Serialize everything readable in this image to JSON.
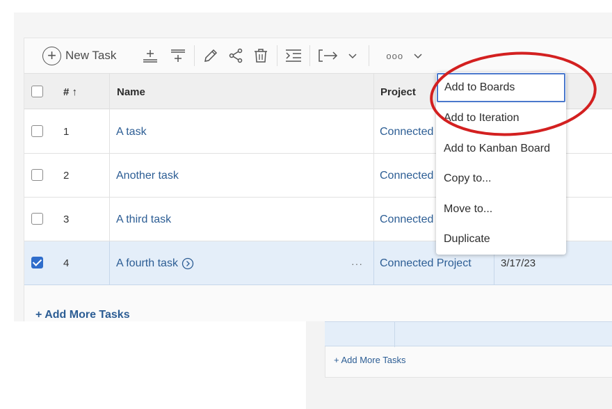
{
  "toolbar": {
    "new_task_label": "New Task",
    "new_task_icon": "plus-circle-icon",
    "icons": [
      "insert-above-icon",
      "insert-below-icon",
      "edit-icon",
      "share-icon",
      "delete-icon",
      "indent-icon",
      "move-icon",
      "chevron-down-icon",
      "more-icon",
      "chevron-down-icon"
    ],
    "more_glyph": "ooo"
  },
  "table": {
    "columns": {
      "number": "# ↑",
      "name": "Name",
      "project": "Project"
    },
    "rows": [
      {
        "number": "1",
        "name": "A task",
        "project": "Connected",
        "checked": false
      },
      {
        "number": "2",
        "name": "Another task",
        "project": "Connected",
        "checked": false
      },
      {
        "number": "3",
        "name": "A third task",
        "project": "Connected",
        "checked": false
      },
      {
        "number": "4",
        "name": "A fourth task",
        "project": "Connected Project",
        "date": "3/17/23",
        "checked": true,
        "row_actions": "···"
      }
    ],
    "add_more": "+ Add More Tasks"
  },
  "context_menu": {
    "items": [
      "Add to Boards",
      "Add to Iteration",
      "Add to Kanban Board",
      "Copy to...",
      "Move to...",
      "Duplicate"
    ],
    "focused_item": "Add to Boards"
  },
  "background_panel": {
    "add_more": "+ Add More Tasks"
  },
  "colors": {
    "link": "#2c5d94",
    "selected_row": "#e4eef9",
    "checkbox_checked": "#2f6dcb",
    "annotation_circle": "#d32020",
    "focus_ring": "#4a78cc"
  }
}
